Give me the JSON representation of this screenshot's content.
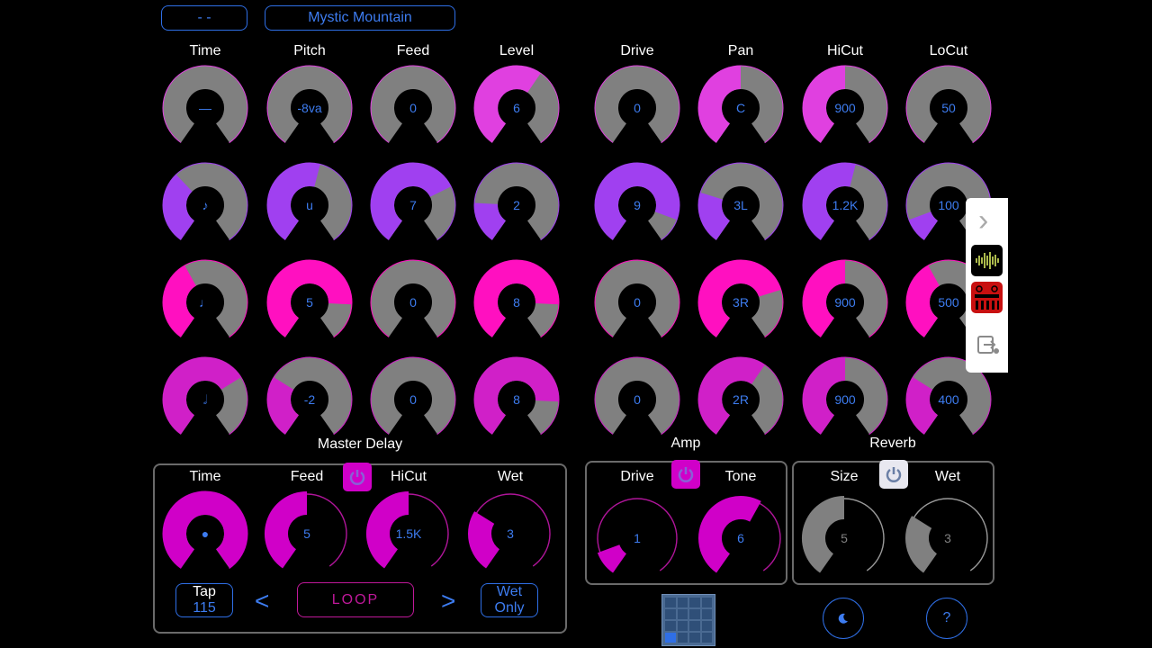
{
  "header": {
    "preset_short": "- -",
    "preset_name": "Mystic Mountain"
  },
  "columns": [
    "Time",
    "Pitch",
    "Feed",
    "Level",
    "Drive",
    "Pan",
    "HiCut",
    "LoCut"
  ],
  "rows": [
    {
      "color": "#e040e0",
      "values": [
        "—",
        "-8va",
        "0",
        "6",
        "0",
        "C",
        "900",
        "50"
      ],
      "levels": [
        0,
        0,
        0,
        0.62,
        0,
        0.5,
        0.5,
        0
      ]
    },
    {
      "color": "#a040f0",
      "values": [
        "♪",
        "u",
        "7",
        "2",
        "9",
        "3L",
        "1.2K",
        "100"
      ],
      "levels": [
        0.35,
        0.55,
        0.72,
        0.2,
        0.88,
        0.25,
        0.55,
        0.12
      ]
    },
    {
      "color": "#ff10c0",
      "values": [
        "♩",
        "5",
        "0",
        "8",
        "0",
        "3R",
        "900",
        "500"
      ],
      "levels": [
        0.4,
        0.82,
        0,
        0.82,
        0,
        0.75,
        0.5,
        0.4
      ]
    },
    {
      "color": "#d020c8",
      "values": [
        "𝅗𝅥",
        "-2",
        "0",
        "8",
        "0",
        "2R",
        "900",
        "400"
      ],
      "levels": [
        0.7,
        0.3,
        0,
        0.82,
        0,
        0.62,
        0.5,
        0.3
      ]
    }
  ],
  "master_delay": {
    "title": "Master Delay",
    "knobs": [
      {
        "label": "Time",
        "value": "●",
        "level": 1.0
      },
      {
        "label": "Feed",
        "value": "5",
        "level": 0.5
      },
      {
        "label": "HiCut",
        "value": "1.5K",
        "level": 0.5
      },
      {
        "label": "Wet",
        "value": "3",
        "level": 0.3
      }
    ],
    "tap_label": "Tap",
    "tap_bpm": "115",
    "loop_label": "LOOP",
    "wet_only": "Wet Only"
  },
  "amp": {
    "title": "Amp",
    "knobs": [
      {
        "label": "Drive",
        "value": "1",
        "level": 0.12
      },
      {
        "label": "Tone",
        "value": "6",
        "level": 0.6
      }
    ]
  },
  "reverb": {
    "title": "Reverb",
    "knobs": [
      {
        "label": "Size",
        "value": "5",
        "level": 0.5
      },
      {
        "label": "Wet",
        "value": "3",
        "level": 0.3
      }
    ]
  },
  "bottom": {
    "moon_icon": "moon-icon",
    "help_label": "?"
  },
  "sidebar": {
    "chevron": "›"
  },
  "colors": {
    "accent": "#3d7cf0",
    "magenta": "#d000c8",
    "grey": "#808080"
  }
}
